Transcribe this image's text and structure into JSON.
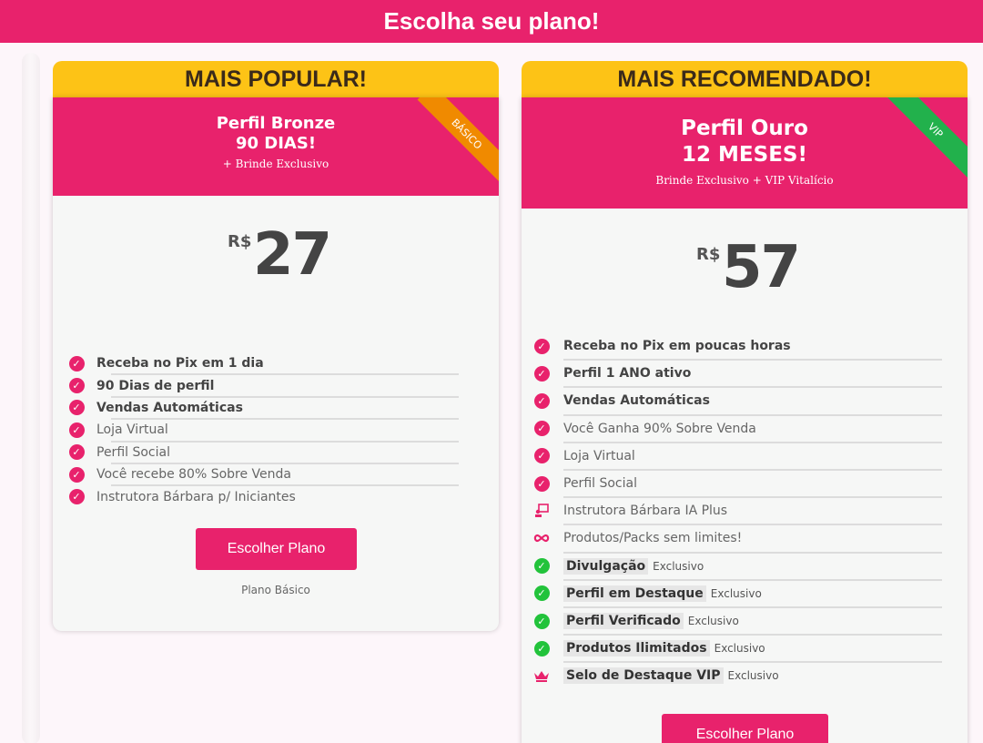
{
  "header": {
    "title": "Escolha seu plano!"
  },
  "colors": {
    "brand": "#e8226c",
    "tag": "#fdc316",
    "basic_ribbon": "#f08a00",
    "vip_ribbon": "#22b14c",
    "check_green": "#22c33b"
  },
  "plans": [
    {
      "tag": "MAIS POPULAR!",
      "name": "Perfil Bronze",
      "duration": "90 DIAS!",
      "bonus": "+ Brinde Exclusivo",
      "ribbon": "BÁSICO",
      "currency": "R$",
      "price": "27",
      "features": [
        {
          "text": "Receba no Pix em 1 dia",
          "bold": true,
          "icon": "check-icon"
        },
        {
          "text": "90 Dias de perfil",
          "bold": true,
          "icon": "check-icon"
        },
        {
          "text": "Vendas Automáticas",
          "bold": true,
          "icon": "check-icon"
        },
        {
          "text": "Loja Virtual",
          "bold": false,
          "icon": "check-icon"
        },
        {
          "text": "Perfil Social",
          "bold": false,
          "icon": "check-icon"
        },
        {
          "text": "Você recebe 80% Sobre Venda",
          "bold": false,
          "icon": "check-icon"
        },
        {
          "text": "Instrutora Bárbara p/ Iniciantes",
          "bold": false,
          "icon": "check-icon"
        }
      ],
      "button": "Escolher Plano",
      "note": "Plano Básico"
    },
    {
      "tag": "MAIS RECOMENDADO!",
      "name": "Perfil Ouro",
      "duration": "12 MESES!",
      "bonus": "Brinde Exclusivo + VIP Vitalício",
      "ribbon": "VIP",
      "currency": "R$",
      "price": "57",
      "features": [
        {
          "text": "Receba no Pix em poucas horas",
          "bold": true,
          "icon": "check-icon"
        },
        {
          "text": "Perfil 1 ANO ativo",
          "bold": true,
          "icon": "check-icon"
        },
        {
          "text": "Vendas Automáticas",
          "bold": true,
          "icon": "check-icon"
        },
        {
          "text": "Você Ganha 90% Sobre Venda",
          "bold": false,
          "icon": "check-icon"
        },
        {
          "text": "Loja Virtual",
          "bold": false,
          "icon": "check-icon"
        },
        {
          "text": "Perfil Social",
          "bold": false,
          "icon": "check-icon"
        },
        {
          "text": "Instrutora Bárbara IA Plus",
          "bold": false,
          "icon": "teacher-icon"
        },
        {
          "text": "Produtos/Packs sem limites!",
          "bold": false,
          "icon": "infinity-icon"
        },
        {
          "text": "Divulgação",
          "chip": true,
          "extra": "Exclusivo",
          "icon": "green-check-icon"
        },
        {
          "text": "Perfil em Destaque",
          "chip": true,
          "extra": "Exclusivo",
          "icon": "green-check-icon"
        },
        {
          "text": "Perfil Verificado",
          "chip": true,
          "extra": "Exclusivo",
          "icon": "green-check-icon"
        },
        {
          "text": "Produtos Ilimitados",
          "chip": true,
          "extra": "Exclusivo",
          "icon": "green-check-icon"
        },
        {
          "text": "Selo de Destaque VIP",
          "chip": true,
          "extra": "Exclusivo",
          "icon": "crown-icon"
        }
      ],
      "button": "Escolher Plano"
    }
  ]
}
